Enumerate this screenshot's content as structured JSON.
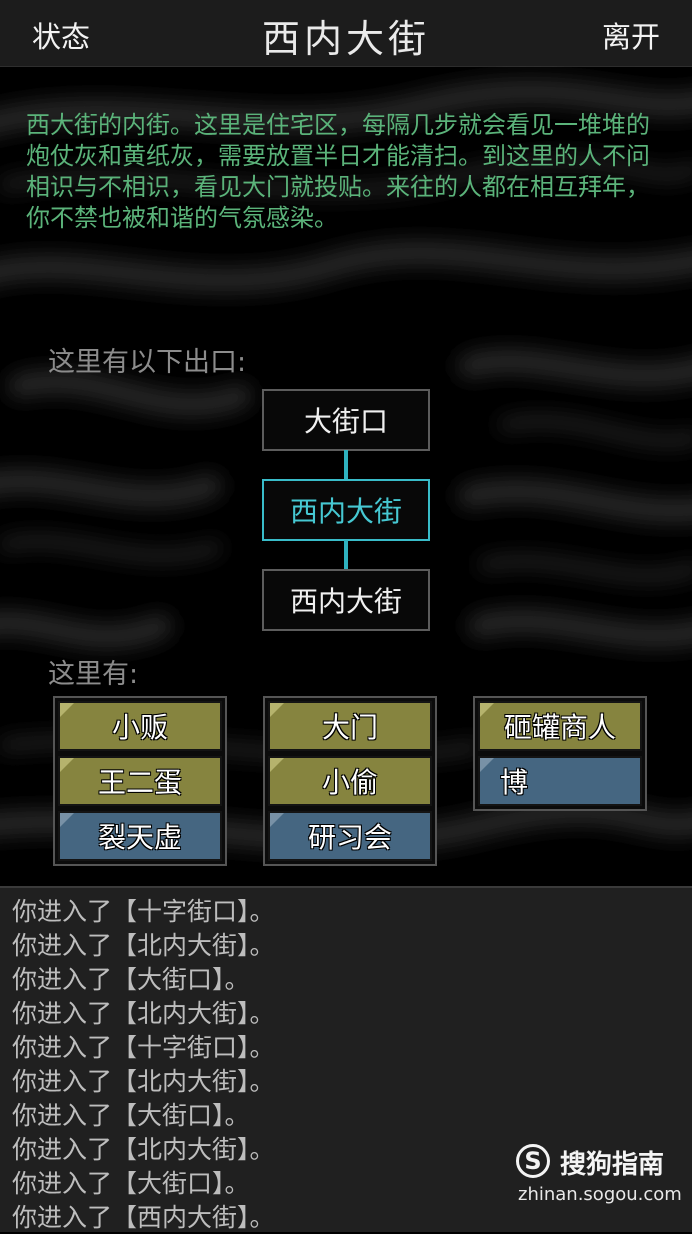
{
  "header": {
    "left_button": "状态",
    "title": "西内大街",
    "right_button": "离开"
  },
  "description": "西大街的内街。这里是住宅区，每隔几步就会看见一堆堆的炮仗灰和黄纸灰，需要放置半日才能清扫。到这里的人不问相识与不相识，看见大门就投贴。来往的人都在相互拜年，你不禁也被和谐的气氛感染。",
  "exits": {
    "label": "这里有以下出口:",
    "top": "大街口",
    "current": "西内大街",
    "bottom": "西内大街"
  },
  "npcs": {
    "label": "这里有:",
    "columns": [
      [
        {
          "name": "小贩",
          "style": "olive"
        },
        {
          "name": "王二蛋",
          "style": "olive"
        },
        {
          "name": "裂天虚",
          "style": "blue"
        }
      ],
      [
        {
          "name": "大门",
          "style": "olive"
        },
        {
          "name": "小偷",
          "style": "olive"
        },
        {
          "name": "研习会",
          "style": "blue"
        }
      ],
      [
        {
          "name": "砸罐商人",
          "style": "olive"
        },
        {
          "name": "博",
          "style": "blue"
        }
      ]
    ]
  },
  "log": [
    "你进入了【十字街口】。",
    "你进入了【北内大街】。",
    "你进入了【大街口】。",
    "你进入了【北内大街】。",
    "你进入了【十字街口】。",
    "你进入了【北内大街】。",
    "你进入了【大街口】。",
    "你进入了【北内大街】。",
    "你进入了【大街口】。",
    "你进入了【西内大街】。"
  ],
  "watermark": {
    "logo_glyph": "S",
    "name": "搜狗指南",
    "url": "zhinan.sogou.com"
  },
  "colors": {
    "description_text": "#5bb37a",
    "current_exit": "#39bcc9",
    "npc_olive": "#86843f",
    "npc_blue": "#456681"
  }
}
